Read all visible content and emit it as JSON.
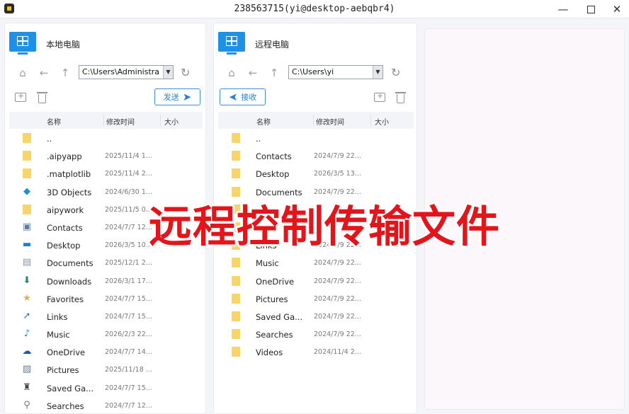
{
  "window": {
    "title": "238563715(yi@desktop-aebqbr4)",
    "minimize": "—",
    "close": "✕"
  },
  "left": {
    "title": "本地电脑",
    "path": "C:\\Users\\Administra",
    "action": "发送",
    "columns": {
      "name": "名称",
      "modified": "修改时间",
      "size": "大小"
    },
    "rows": [
      {
        "icon": "folder-icon",
        "name": "..",
        "date": ""
      },
      {
        "icon": "folder-icon",
        "name": ".aipyapp",
        "date": "2025/11/4 1..."
      },
      {
        "icon": "folder-icon",
        "name": ".matplotlib",
        "date": "2025/11/4 2..."
      },
      {
        "icon": "3d-objects-icon",
        "name": "3D Objects",
        "date": "2024/6/30 1..."
      },
      {
        "icon": "folder-icon",
        "name": "aipywork",
        "date": "2025/11/5 0..."
      },
      {
        "icon": "contacts-icon",
        "name": "Contacts",
        "date": "2024/7/7 12..."
      },
      {
        "icon": "desktop-icon",
        "name": "Desktop",
        "date": "2026/3/5 10..."
      },
      {
        "icon": "documents-icon",
        "name": "Documents",
        "date": "2025/12/1 2..."
      },
      {
        "icon": "downloads-icon",
        "name": "Downloads",
        "date": "2026/3/1 17..."
      },
      {
        "icon": "favorites-icon",
        "name": "Favorites",
        "date": "2024/7/7 15..."
      },
      {
        "icon": "links-icon",
        "name": "Links",
        "date": "2024/7/7 15..."
      },
      {
        "icon": "music-icon",
        "name": "Music",
        "date": "2026/2/3 22..."
      },
      {
        "icon": "onedrive-icon",
        "name": "OneDrive",
        "date": "2024/7/7 14..."
      },
      {
        "icon": "pictures-icon",
        "name": "Pictures",
        "date": "2025/11/18 ..."
      },
      {
        "icon": "saved-games-icon",
        "name": "Saved Ga...",
        "date": "2024/7/7 15..."
      },
      {
        "icon": "searches-icon",
        "name": "Searches",
        "date": "2024/7/7 12..."
      }
    ]
  },
  "remote": {
    "title": "远程电脑",
    "path": "C:\\Users\\yi",
    "action": "接收",
    "columns": {
      "name": "名称",
      "modified": "修改时间",
      "size": "大小"
    },
    "rows": [
      {
        "name": "..",
        "date": ""
      },
      {
        "name": "Contacts",
        "date": "2024/7/9 22..."
      },
      {
        "name": "Desktop",
        "date": "2026/3/5 13..."
      },
      {
        "name": "Documents",
        "date": "2024/7/9 22..."
      },
      {
        "name": "",
        "date": ""
      },
      {
        "name": "",
        "date": ""
      },
      {
        "name": "Links",
        "date": "2024/7/9 22..."
      },
      {
        "name": "Music",
        "date": "2024/7/9 22..."
      },
      {
        "name": "OneDrive",
        "date": "2024/7/9 22..."
      },
      {
        "name": "Pictures",
        "date": "2024/7/9 22..."
      },
      {
        "name": "Saved Ga...",
        "date": "2024/7/9 22..."
      },
      {
        "name": "Searches",
        "date": "2024/7/9 22..."
      },
      {
        "name": "Videos",
        "date": "2024/11/4 2..."
      }
    ]
  },
  "overlay_caption": "远程控制传输文件",
  "colors": {
    "accent": "#1e90e6",
    "folder": "#f7d568",
    "caption": "#e4141b"
  }
}
